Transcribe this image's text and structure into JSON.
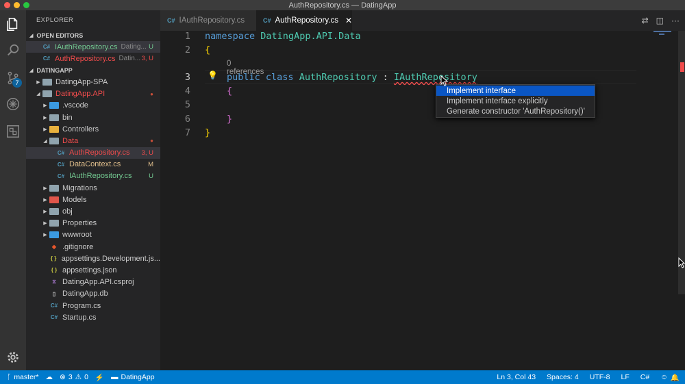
{
  "window": {
    "title": "AuthRepository.cs — DatingApp",
    "traffic_colors": [
      "#fe5f57",
      "#febc2e",
      "#28c840"
    ]
  },
  "activity_bar": {
    "icons": [
      "files-icon",
      "search-icon",
      "source-control-icon",
      "debug-icon",
      "extensions-icon",
      "gear-icon"
    ],
    "scm_badge": "7"
  },
  "explorer": {
    "title": "EXPLORER",
    "open_editors_header": "OPEN EDITORS",
    "open_editors": [
      {
        "name": "IAuthRepository.cs",
        "folder": "Dating...",
        "decoration": "U",
        "status": "untracked"
      },
      {
        "name": "AuthRepository.cs",
        "folder": "Datin...",
        "decoration": "3, U",
        "status": "error"
      }
    ],
    "workspace_header": "DATINGAPP",
    "tree": [
      {
        "label": "DatingApp-SPA",
        "depth": 1,
        "arrow": "▶",
        "icon": "folder",
        "color": "#cccccc"
      },
      {
        "label": "DatingApp.API",
        "depth": 1,
        "arrow": "◢",
        "icon": "folder",
        "status": "error",
        "dot": true
      },
      {
        "label": ".vscode",
        "depth": 2,
        "arrow": "▶",
        "icon": "folder-vscode"
      },
      {
        "label": "bin",
        "depth": 2,
        "arrow": "▶",
        "icon": "folder"
      },
      {
        "label": "Controllers",
        "depth": 2,
        "arrow": "▶",
        "icon": "folder-controllers"
      },
      {
        "label": "Data",
        "depth": 2,
        "arrow": "◢",
        "icon": "folder-data",
        "status": "error",
        "dot": true
      },
      {
        "label": "AuthRepository.cs",
        "depth": 3,
        "icon": "csharp",
        "status": "error",
        "decoration": "3, U",
        "selected": true
      },
      {
        "label": "DataContext.cs",
        "depth": 3,
        "icon": "csharp",
        "status": "modified",
        "decoration": "M"
      },
      {
        "label": "IAuthRepository.cs",
        "depth": 3,
        "icon": "csharp",
        "status": "untracked",
        "decoration": "U"
      },
      {
        "label": "Migrations",
        "depth": 2,
        "arrow": "▶",
        "icon": "folder"
      },
      {
        "label": "Models",
        "depth": 2,
        "arrow": "▶",
        "icon": "folder-models"
      },
      {
        "label": "obj",
        "depth": 2,
        "arrow": "▶",
        "icon": "folder"
      },
      {
        "label": "Properties",
        "depth": 2,
        "arrow": "▶",
        "icon": "folder"
      },
      {
        "label": "wwwroot",
        "depth": 2,
        "arrow": "▶",
        "icon": "folder-www"
      },
      {
        "label": ".gitignore",
        "depth": 2,
        "icon": "git"
      },
      {
        "label": "appsettings.Development.js...",
        "depth": 2,
        "icon": "json"
      },
      {
        "label": "appsettings.json",
        "depth": 2,
        "icon": "json"
      },
      {
        "label": "DatingApp.API.csproj",
        "depth": 2,
        "icon": "csproj"
      },
      {
        "label": "DatingApp.db",
        "depth": 2,
        "icon": "db"
      },
      {
        "label": "Program.cs",
        "depth": 2,
        "icon": "csharp"
      },
      {
        "label": "Startup.cs",
        "depth": 2,
        "icon": "csharp"
      }
    ]
  },
  "tabs": [
    {
      "label": "IAuthRepository.cs",
      "active": false
    },
    {
      "label": "AuthRepository.cs",
      "active": true
    }
  ],
  "editor": {
    "line_numbers": [
      "1",
      "2",
      "3",
      "4",
      "5",
      "6",
      "7"
    ],
    "codelens": "0 references",
    "lines": {
      "l1_kw": "namespace",
      "l1_ns": "DatingApp.API.Data",
      "l2": "{",
      "l3_kw": "public class",
      "l3_cls": "AuthRepository",
      "l3_colon": ":",
      "l3_iface": "IAuthRepository",
      "l4": "{",
      "l6": "}",
      "l7": "}"
    }
  },
  "quick_fix": {
    "items": [
      "Implement interface",
      "Implement interface explicitly",
      "Generate constructor 'AuthRepository()'"
    ]
  },
  "status_bar": {
    "branch": "master*",
    "errors": "3",
    "warnings": "0",
    "project": "DatingApp",
    "position": "Ln 3, Col 43",
    "spaces": "Spaces: 4",
    "encoding": "UTF-8",
    "eol": "LF",
    "language": "C#"
  }
}
